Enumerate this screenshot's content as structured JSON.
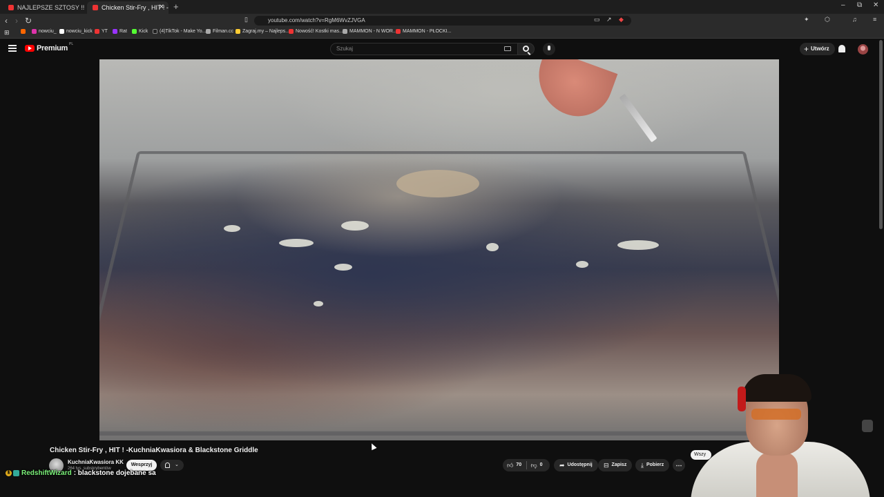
{
  "browser": {
    "tabs": [
      {
        "title": "NAJLEPSZE SZTOSY !! Elewador !!"
      },
      {
        "title": "Chicken Stir-Fry , HIT ! -Kuchni"
      }
    ],
    "url": "youtube.com/watch?v=RgM6WvZJVGA",
    "bookmarks": [
      {
        "label": "nowciu_"
      },
      {
        "label": "nowciu_kick"
      },
      {
        "label": "YT"
      },
      {
        "label": "Rat"
      },
      {
        "label": "Kick"
      },
      {
        "label": "(4)TikTok - Make Yo..."
      },
      {
        "label": "Filman.cc"
      },
      {
        "label": "Zagraj.my – Najleps..."
      },
      {
        "label": "Nowość! Kostki mas..."
      },
      {
        "label": "MAMMON - N WOR..."
      },
      {
        "label": "MAMMON - PŁOCKI..."
      }
    ],
    "window_controls": {
      "minimize": "–",
      "restore": "⧉",
      "close": "✕"
    },
    "new_tab": "+"
  },
  "youtube": {
    "logo_text": "Premium",
    "country_code": "PL",
    "search_placeholder": "Szukaj",
    "create_label": "Utwórz"
  },
  "video": {
    "title": "Chicken Stir-Fry , HIT ! -KuchniaKwasiora & Blackstone Griddle",
    "channel": "KuchniaKwasiora KK",
    "subscribers": "264 tys. subskrybentów",
    "join_label": "Wesprzyj",
    "likes": "70",
    "dislikes": "0",
    "share_label": "Udostępnij",
    "save_label": "Zapisz",
    "download_label": "Pobierz",
    "more_label": "⋯",
    "chip_partial": "Wszy"
  },
  "chat_overlay": {
    "username": "RedshiftWizard",
    "message": ": blackstone dojebane sa"
  },
  "colors": {
    "background": "#0f0f0f",
    "accent_red": "#ff0000",
    "chat_username": "#7cf27a"
  }
}
